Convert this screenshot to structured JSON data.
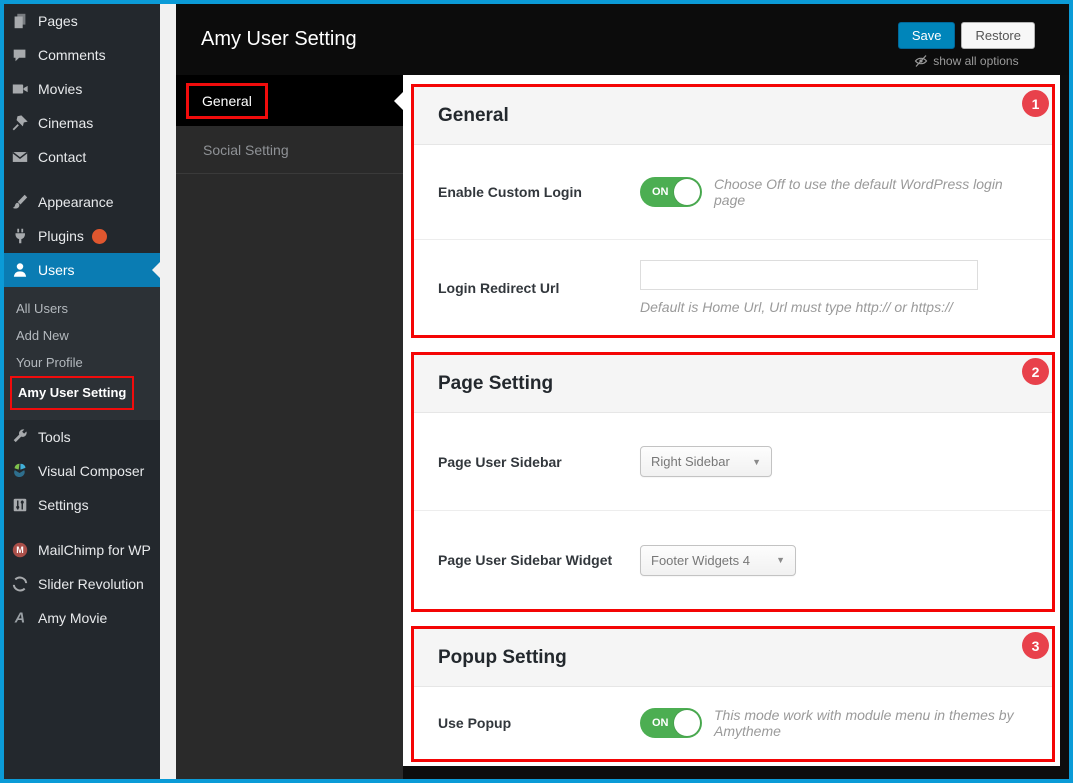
{
  "header": {
    "title": "Amy User Setting",
    "save_label": "Save",
    "restore_label": "Restore",
    "show_all_options": "show all options"
  },
  "sidebar": {
    "menu": [
      {
        "label": "Pages",
        "icon": "pages-icon"
      },
      {
        "label": "Comments",
        "icon": "comments-icon"
      },
      {
        "label": "Movies",
        "icon": "movies-icon"
      },
      {
        "label": "Cinemas",
        "icon": "cinemas-icon"
      },
      {
        "label": "Contact",
        "icon": "contact-icon"
      },
      {
        "label": "Appearance",
        "icon": "appearance-icon"
      },
      {
        "label": "Plugins",
        "icon": "plugins-icon",
        "has_update_badge": true
      },
      {
        "label": "Users",
        "icon": "users-icon",
        "active": true
      }
    ],
    "submenu": [
      {
        "label": "All Users"
      },
      {
        "label": "Add New"
      },
      {
        "label": "Your Profile"
      },
      {
        "label": "Amy User Setting",
        "current": true,
        "annotated": true
      }
    ],
    "menu2": [
      {
        "label": "Tools",
        "icon": "tools-icon"
      },
      {
        "label": "Visual Composer",
        "icon": "visual-composer-icon"
      },
      {
        "label": "Settings",
        "icon": "settings-icon"
      },
      {
        "label": "MailChimp for WP",
        "icon": "mailchimp-icon"
      },
      {
        "label": "Slider Revolution",
        "icon": "slider-revolution-icon"
      },
      {
        "label": "Amy Movie",
        "icon": "amy-movie-icon"
      }
    ]
  },
  "tabs": [
    {
      "label": "General",
      "active": true,
      "annotated": true
    },
    {
      "label": "Social Setting"
    }
  ],
  "sections": [
    {
      "badge": "1",
      "title": "General",
      "rows": [
        {
          "label": "Enable Custom Login",
          "control": "toggle",
          "toggle_state": "ON",
          "help": "Choose Off to use the default WordPress login page"
        },
        {
          "label": "Login Redirect Url",
          "control": "input",
          "value": "",
          "help": "Default is Home Url, Url must type http:// or https://"
        }
      ]
    },
    {
      "badge": "2",
      "title": "Page Setting",
      "rows": [
        {
          "label": "Page User Sidebar",
          "control": "select",
          "value": "Right Sidebar"
        },
        {
          "label": "Page User Sidebar Widget",
          "control": "select",
          "value": "Footer Widgets 4"
        }
      ]
    },
    {
      "badge": "3",
      "title": "Popup Setting",
      "rows": [
        {
          "label": "Use Popup",
          "control": "toggle",
          "toggle_state": "ON",
          "help": "This mode work with module menu in themes by Amytheme"
        }
      ]
    }
  ],
  "colors": {
    "frame_border": "#0b9bd7",
    "sidebar_bg": "#23282d",
    "active_menu_blue": "#0a7cb3",
    "annotation_red": "#f10c0c",
    "toggle_green": "#4cae52",
    "save_button_blue": "#0085ba"
  }
}
